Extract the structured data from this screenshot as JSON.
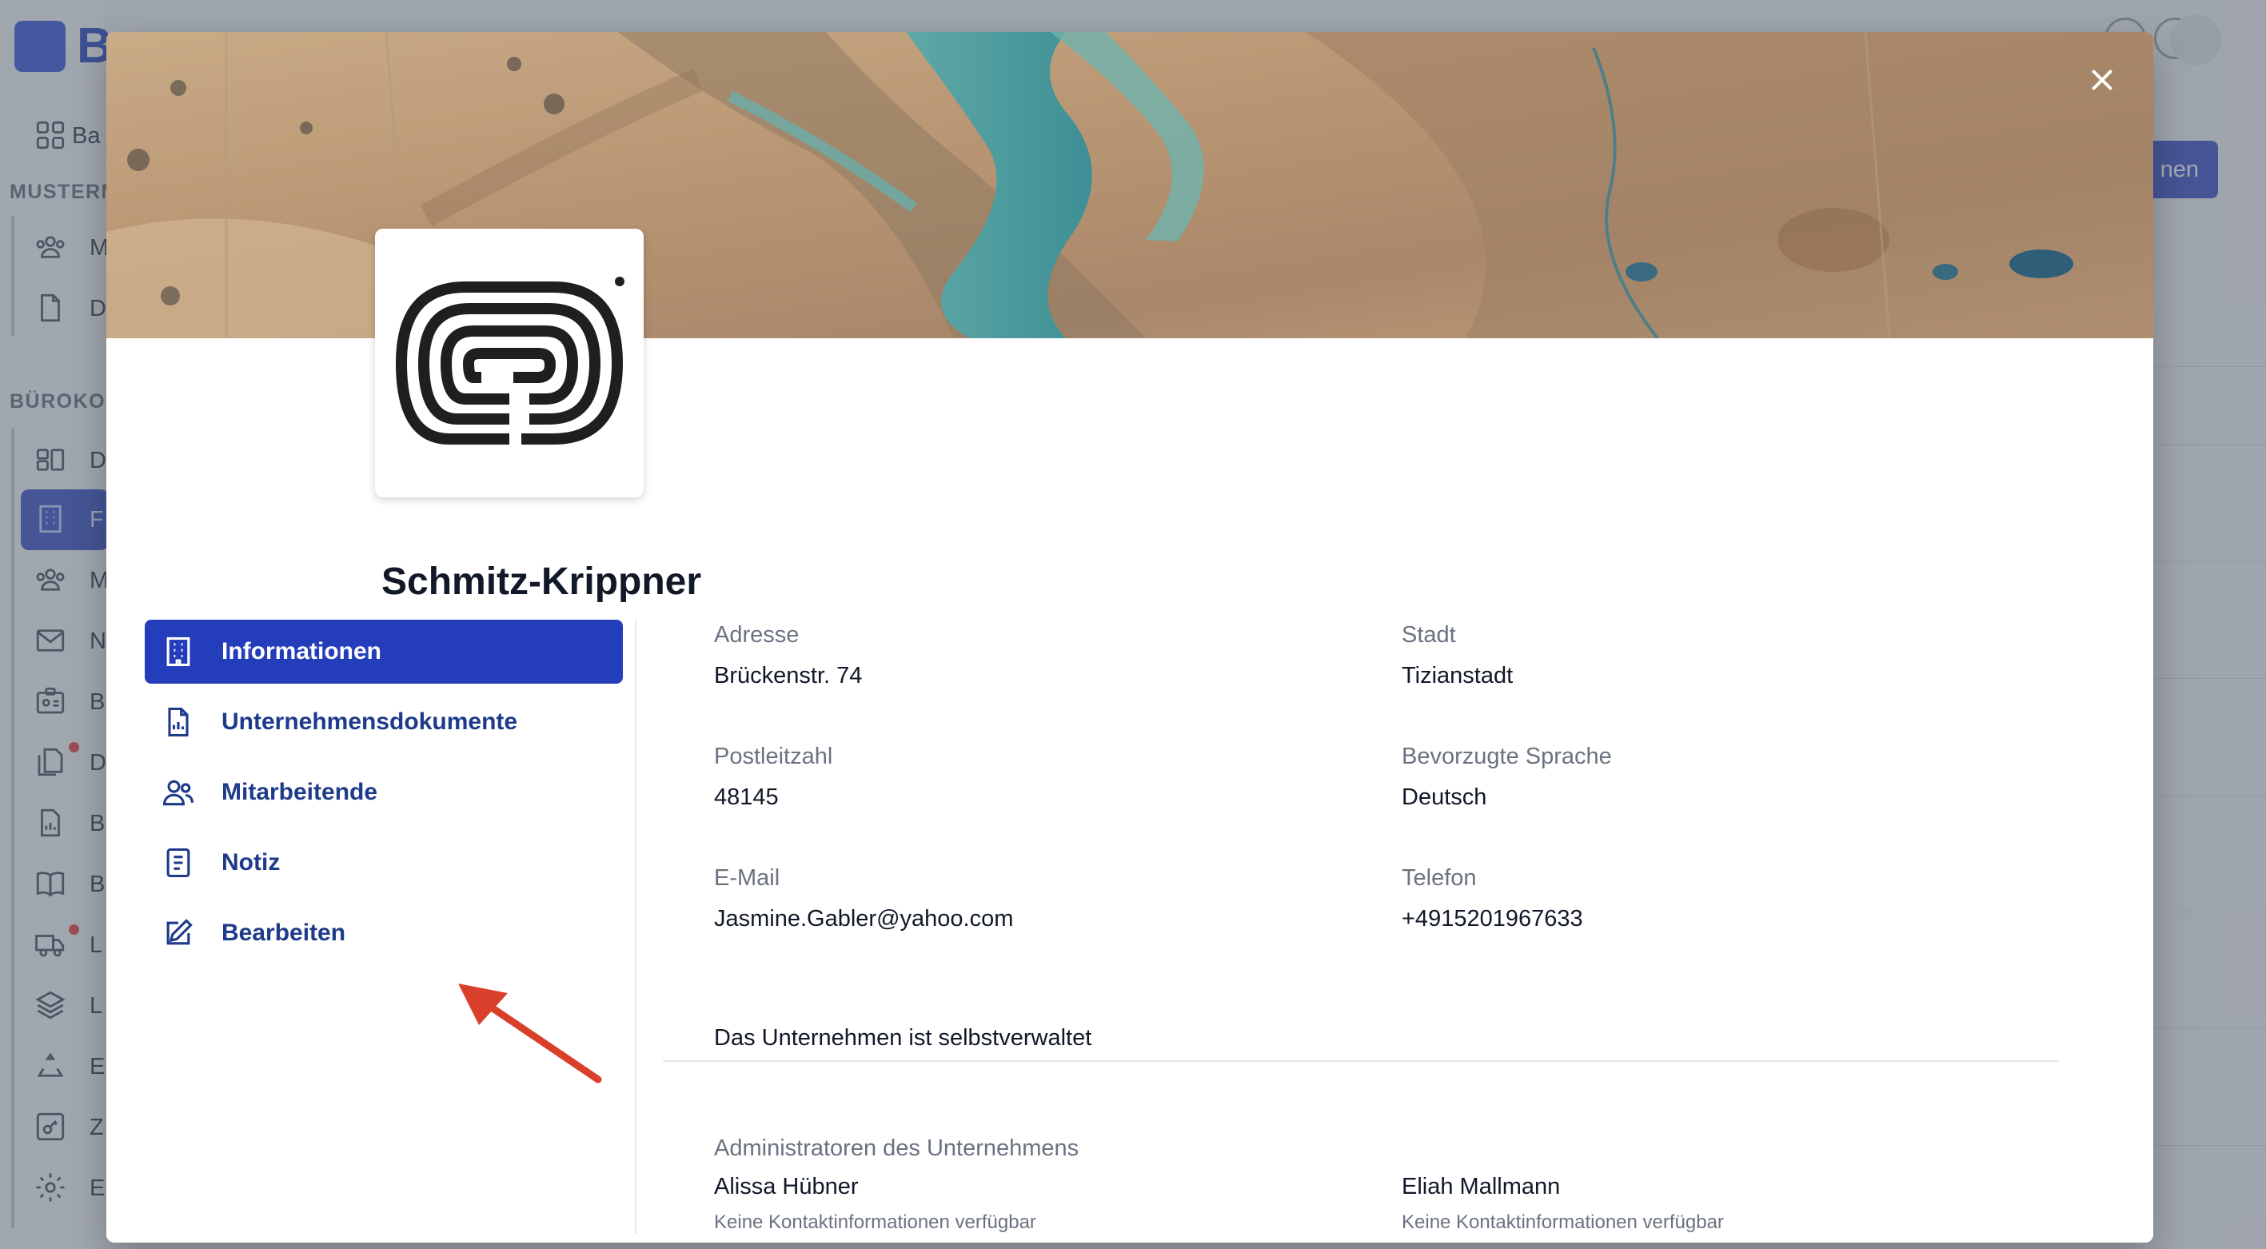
{
  "background": {
    "app_letter": "B",
    "sidebar_sections": [
      "MUSTERM",
      "BÜROKOM"
    ],
    "sidebar_items": [
      {
        "letter": "Ba",
        "icon": "grid-icon"
      },
      {
        "letter": "M",
        "icon": "users-icon"
      },
      {
        "letter": "D",
        "icon": "document-icon"
      },
      {
        "letter": "D",
        "icon": "layout-icon"
      },
      {
        "letter": "F",
        "icon": "building-icon"
      },
      {
        "letter": "M",
        "icon": "users-icon"
      },
      {
        "letter": "N",
        "icon": "mail-icon"
      },
      {
        "letter": "B",
        "icon": "id-badge-icon"
      },
      {
        "letter": "D",
        "icon": "documents-icon"
      },
      {
        "letter": "B",
        "icon": "report-icon"
      },
      {
        "letter": "B",
        "icon": "book-icon"
      },
      {
        "letter": "L",
        "icon": "truck-icon"
      },
      {
        "letter": "L",
        "icon": "layers-icon"
      },
      {
        "letter": "E",
        "icon": "recycle-icon"
      },
      {
        "letter": "Z",
        "icon": "key-icon"
      },
      {
        "letter": "E",
        "icon": "gear-icon"
      }
    ],
    "button_label": "nen"
  },
  "modal": {
    "company_name": "Schmitz-Krippner",
    "nav": [
      {
        "label": "Informationen",
        "icon": "building-icon",
        "active": true
      },
      {
        "label": "Unternehmensdokumente",
        "icon": "document-icon",
        "active": false
      },
      {
        "label": "Mitarbeitende",
        "icon": "users-icon",
        "active": false
      },
      {
        "label": "Notiz",
        "icon": "note-icon",
        "active": false
      },
      {
        "label": "Bearbeiten",
        "icon": "edit-icon",
        "active": false
      }
    ],
    "fields": {
      "address": {
        "label": "Adresse",
        "value": "Brückenstr. 74"
      },
      "city": {
        "label": "Stadt",
        "value": "Tizianstadt"
      },
      "postal": {
        "label": "Postleitzahl",
        "value": "48145"
      },
      "language": {
        "label": "Bevorzugte Sprache",
        "value": "Deutsch"
      },
      "email": {
        "label": "E-Mail",
        "value": "Jasmine.Gabler@yahoo.com"
      },
      "phone": {
        "label": "Telefon",
        "value": "+4915201967633"
      }
    },
    "self_managed": "Das Unternehmen ist selbstverwaltet",
    "admins_label": "Administratoren des Unternehmens",
    "admins": [
      {
        "name": "Alissa Hübner",
        "contact": "Keine Kontaktinformationen verfügbar"
      },
      {
        "name": "Eliah Mallmann",
        "contact": "Keine Kontaktinformationen verfügbar"
      }
    ]
  },
  "colors": {
    "primary": "#243dba",
    "nav_text": "#1e3a8a",
    "annotation_arrow": "#d9402b"
  }
}
